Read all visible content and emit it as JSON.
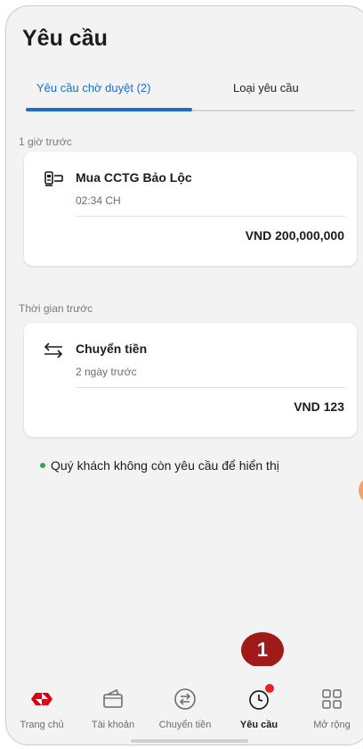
{
  "header": {
    "title": "Yêu cầu"
  },
  "tabs": [
    {
      "label": "Yêu cầu chờ duyệt (2)",
      "active": true
    },
    {
      "label": "Loại yêu cầu",
      "active": false
    }
  ],
  "sections": [
    {
      "label": "1 giờ trước",
      "card": {
        "icon": "card-reader-icon",
        "name": "Mua CCTG Bảo Lộc",
        "time": "02:34 CH",
        "amount": "VND 200,000,000"
      }
    },
    {
      "label": "Thời gian trước",
      "card": {
        "icon": "transfer-arrows-icon",
        "name": "Chuyển tiền",
        "time": "2 ngày trước",
        "amount": "VND 123"
      }
    }
  ],
  "empty_message": "Quý khách không còn yêu cầu để hiển thị",
  "bottom_nav": [
    {
      "label": "Trang chủ",
      "icon": "hsbc-logo-icon",
      "active": false
    },
    {
      "label": "Tài khoản",
      "icon": "wallet-icon",
      "active": false
    },
    {
      "label": "Chuyển tiền",
      "icon": "transfer-icon",
      "active": false
    },
    {
      "label": "Yêu cầu",
      "icon": "clock-icon",
      "active": true,
      "badge": true
    },
    {
      "label": "Mở rộng",
      "icon": "grid-icon",
      "active": false
    }
  ],
  "annotation": {
    "number": "1"
  },
  "colors": {
    "accent": "#1e6ec8",
    "brand_red": "#db0011",
    "badge": "#e8202a",
    "annotation": "#a11a1a"
  }
}
